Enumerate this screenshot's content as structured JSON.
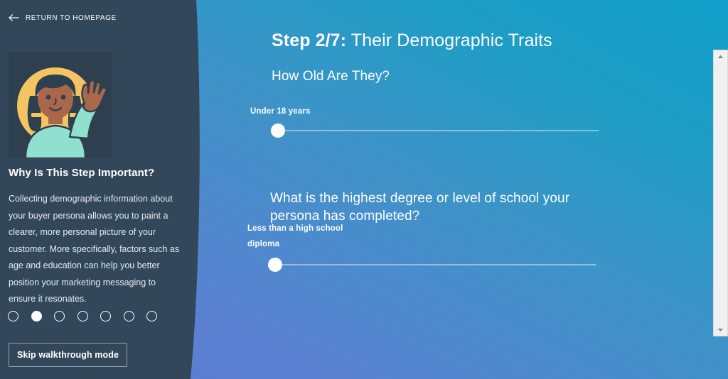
{
  "sidebar": {
    "return_link": {
      "label": "RETURN TO HOMEPAGE",
      "icon": "arrow-left-icon"
    },
    "illustration": {
      "name": "persona-waving-illustration",
      "colors": {
        "tile_background": "#2e3f50",
        "circle": "#f5c462",
        "skin": "#a9674b",
        "hair": "#2e3f50",
        "shirt": "#8fe0cf"
      }
    },
    "why_title": "Why Is This Step Important?",
    "why_body": "Collecting demographic information about your buyer persona allows you to paint a clearer, more personal picture of your customer. More specifically, factors such as age and education can help you better position your marketing messaging to ensure it resonates.",
    "steps": {
      "total": 7,
      "active_index": 1
    },
    "skip_button": "Skip walkthrough mode",
    "background_color": "#33475b"
  },
  "main": {
    "heading": {
      "step_label": "Step 2/7:",
      "title": " Their Demographic Traits"
    },
    "questions": [
      {
        "label": "How Old Are They?",
        "slider": {
          "name": "age-slider",
          "value": "Under 18 years",
          "position_percent": 0
        }
      },
      {
        "label": "What is the highest degree or level of school your persona has completed?",
        "slider": {
          "name": "education-slider",
          "value": "Less than a high school diploma",
          "position_percent": 0
        }
      }
    ],
    "background_gradient": {
      "from": "#6079d4",
      "to": "#119fc9"
    }
  },
  "scrollbar": {
    "name": "vertical-scrollbar",
    "up_icon": "chevron-up-icon",
    "down_icon": "chevron-down-icon",
    "track_color": "#f0f0f0"
  }
}
